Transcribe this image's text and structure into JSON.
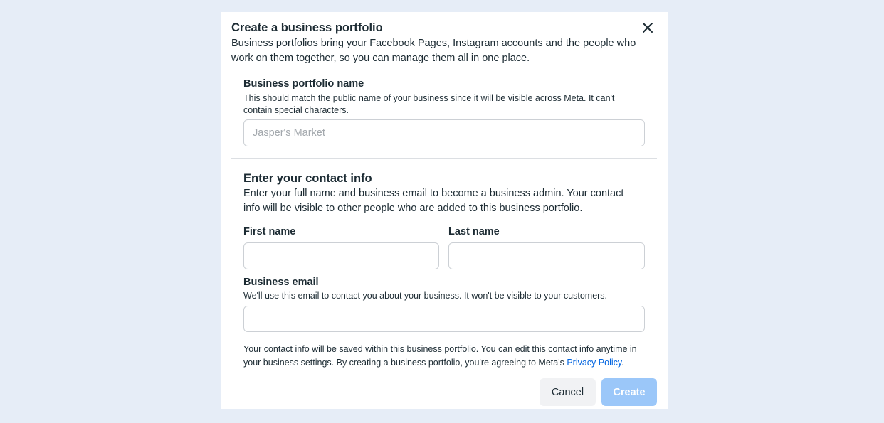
{
  "dialog": {
    "title": "Create a business portfolio",
    "subtitle": "Business portfolios bring your Facebook Pages, Instagram accounts and the people who work on them together, so you can manage them all in one place.",
    "close_icon": "close-icon"
  },
  "portfolio": {
    "label": "Business portfolio name",
    "help": "This should match the public name of your business since it will be visible across Meta. It can't contain special characters.",
    "placeholder": "Jasper's Market",
    "value": ""
  },
  "contact": {
    "title": "Enter your contact info",
    "description": "Enter your full name and business email to become a business admin. Your contact info will be visible to other people who are added to this business portfolio.",
    "first_name_label": "First name",
    "first_name_value": "",
    "last_name_label": "Last name",
    "last_name_value": "",
    "email_label": "Business email",
    "email_help": "We'll use this email to contact you about your business. It won't be visible to your customers.",
    "email_value": ""
  },
  "footer": {
    "note": "Your contact info will be saved within this business portfolio. You can edit this contact info anytime in your business settings. By creating a business portfolio, you're agreeing to Meta's ",
    "privacy_link": "Privacy Policy",
    "note_end": ".",
    "cancel_label": "Cancel",
    "create_label": "Create"
  },
  "colors": {
    "background": "#e6edf7",
    "link": "#0064e0",
    "create_disabled": "#9bc7f9",
    "cancel_bg": "#f1f2f4"
  }
}
